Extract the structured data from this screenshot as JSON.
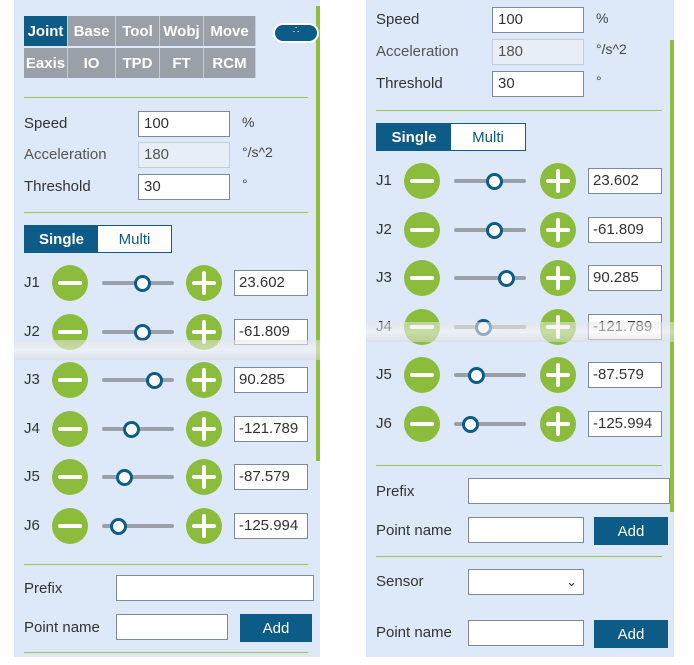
{
  "tabs": [
    {
      "label": "Joint",
      "active": true
    },
    {
      "label": "Base"
    },
    {
      "label": "Tool"
    },
    {
      "label": "Wobj"
    },
    {
      "label": "Move"
    },
    {
      "label": "Eaxis"
    },
    {
      "label": "IO"
    },
    {
      "label": "TPD"
    },
    {
      "label": "FT"
    },
    {
      "label": "RCM"
    }
  ],
  "more_icon": "dots-icon",
  "params": {
    "speed_label": "Speed",
    "speed_value": "100",
    "speed_unit": "%",
    "accel_label": "Acceleration",
    "accel_value": "180",
    "accel_unit": "°/s^2",
    "threshold_label": "Threshold",
    "threshold_value": "30",
    "threshold_unit": "°"
  },
  "mode": {
    "single": "Single",
    "multi": "Multi",
    "selected": "Single"
  },
  "joints": [
    {
      "label": "J1",
      "value": "23.602",
      "level": 0.55
    },
    {
      "label": "J2",
      "value": "-61.809",
      "level": 0.55
    },
    {
      "label": "J3",
      "value": "90.285",
      "level": 0.72
    },
    {
      "label": "J4",
      "value": "-121.789",
      "level": 0.4
    },
    {
      "label": "J5",
      "value": "-87.579",
      "level": 0.3
    },
    {
      "label": "J6",
      "value": "-125.994",
      "level": 0.22
    }
  ],
  "point": {
    "prefix_label": "Prefix",
    "prefix_value": "",
    "name_label": "Point name",
    "name_value": "",
    "add_label": "Add"
  },
  "sensor": {
    "label": "Sensor",
    "value": "",
    "name_label": "Point name",
    "add_label": "Add"
  },
  "colors": {
    "accent": "#0d5b87",
    "green": "#8bbc3c",
    "panel": "#dde9f8"
  }
}
